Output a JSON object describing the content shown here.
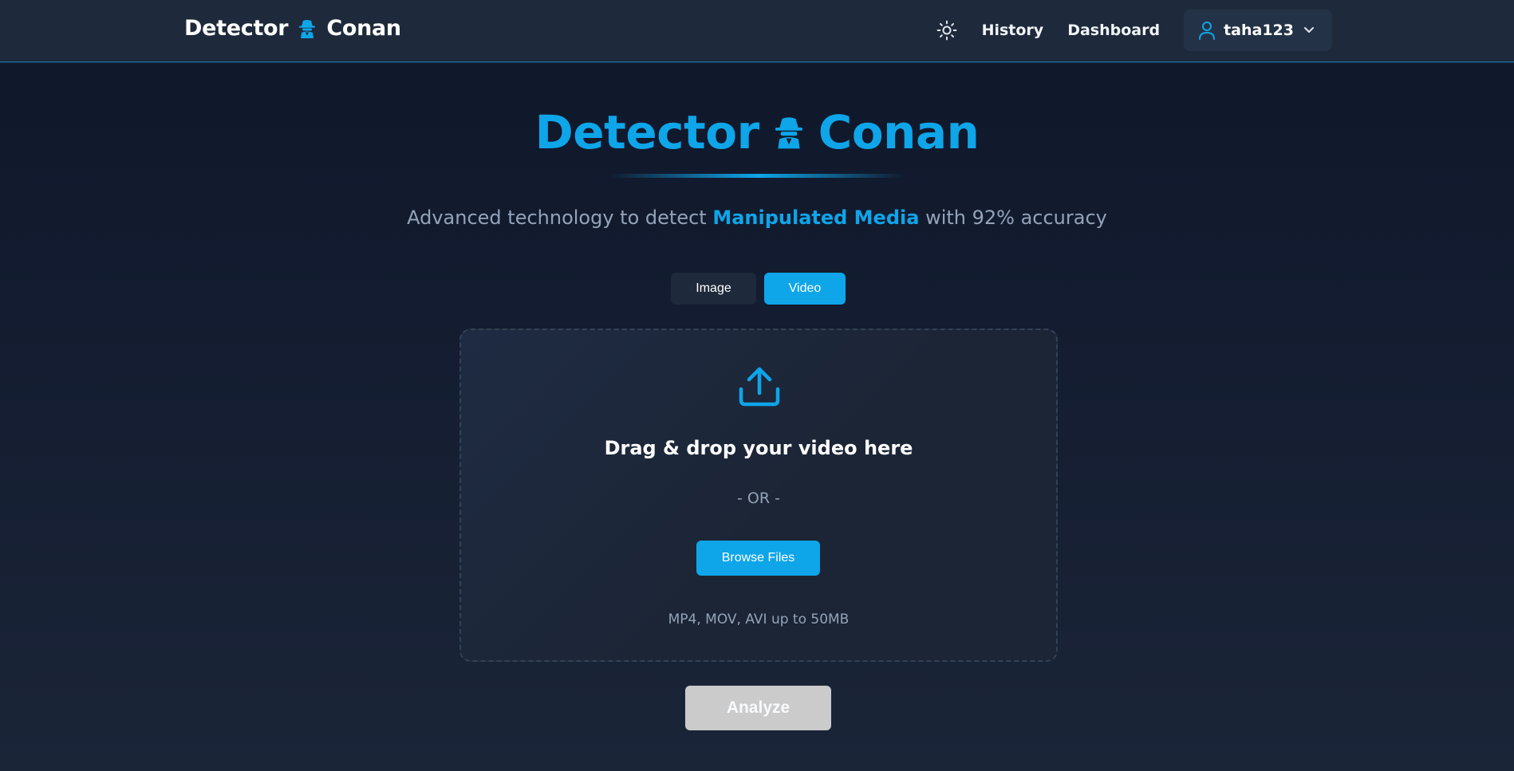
{
  "header": {
    "brand_left": "Detector",
    "brand_right": "Conan",
    "brand_icon": "spy-detective-icon",
    "theme_icon": "sun-icon",
    "nav": {
      "history": "History",
      "dashboard": "Dashboard"
    },
    "user": {
      "name": "taha123",
      "icon": "user-icon",
      "chevron": "chevron-down-icon"
    }
  },
  "hero": {
    "title_left": "Detector",
    "title_right": "Conan",
    "tagline_pre": "Advanced technology to detect ",
    "tagline_highlight": "Manipulated Media",
    "tagline_post": " with 92% accuracy"
  },
  "tabs": {
    "image": "Image",
    "video": "Video",
    "active": "Video"
  },
  "dropzone": {
    "icon": "upload-icon",
    "title": "Drag & drop your video here",
    "or": "- OR -",
    "browse_label": "Browse Files",
    "hint": "MP4, MOV, AVI up to 50MB"
  },
  "analyze": {
    "label": "Analyze",
    "disabled": true
  },
  "colors": {
    "accent": "#0ea5e9",
    "header_bg": "#1e293b",
    "page_bg": "#131b2e",
    "muted_text": "#94a3b8",
    "disabled_button": "#cbcbcb"
  }
}
